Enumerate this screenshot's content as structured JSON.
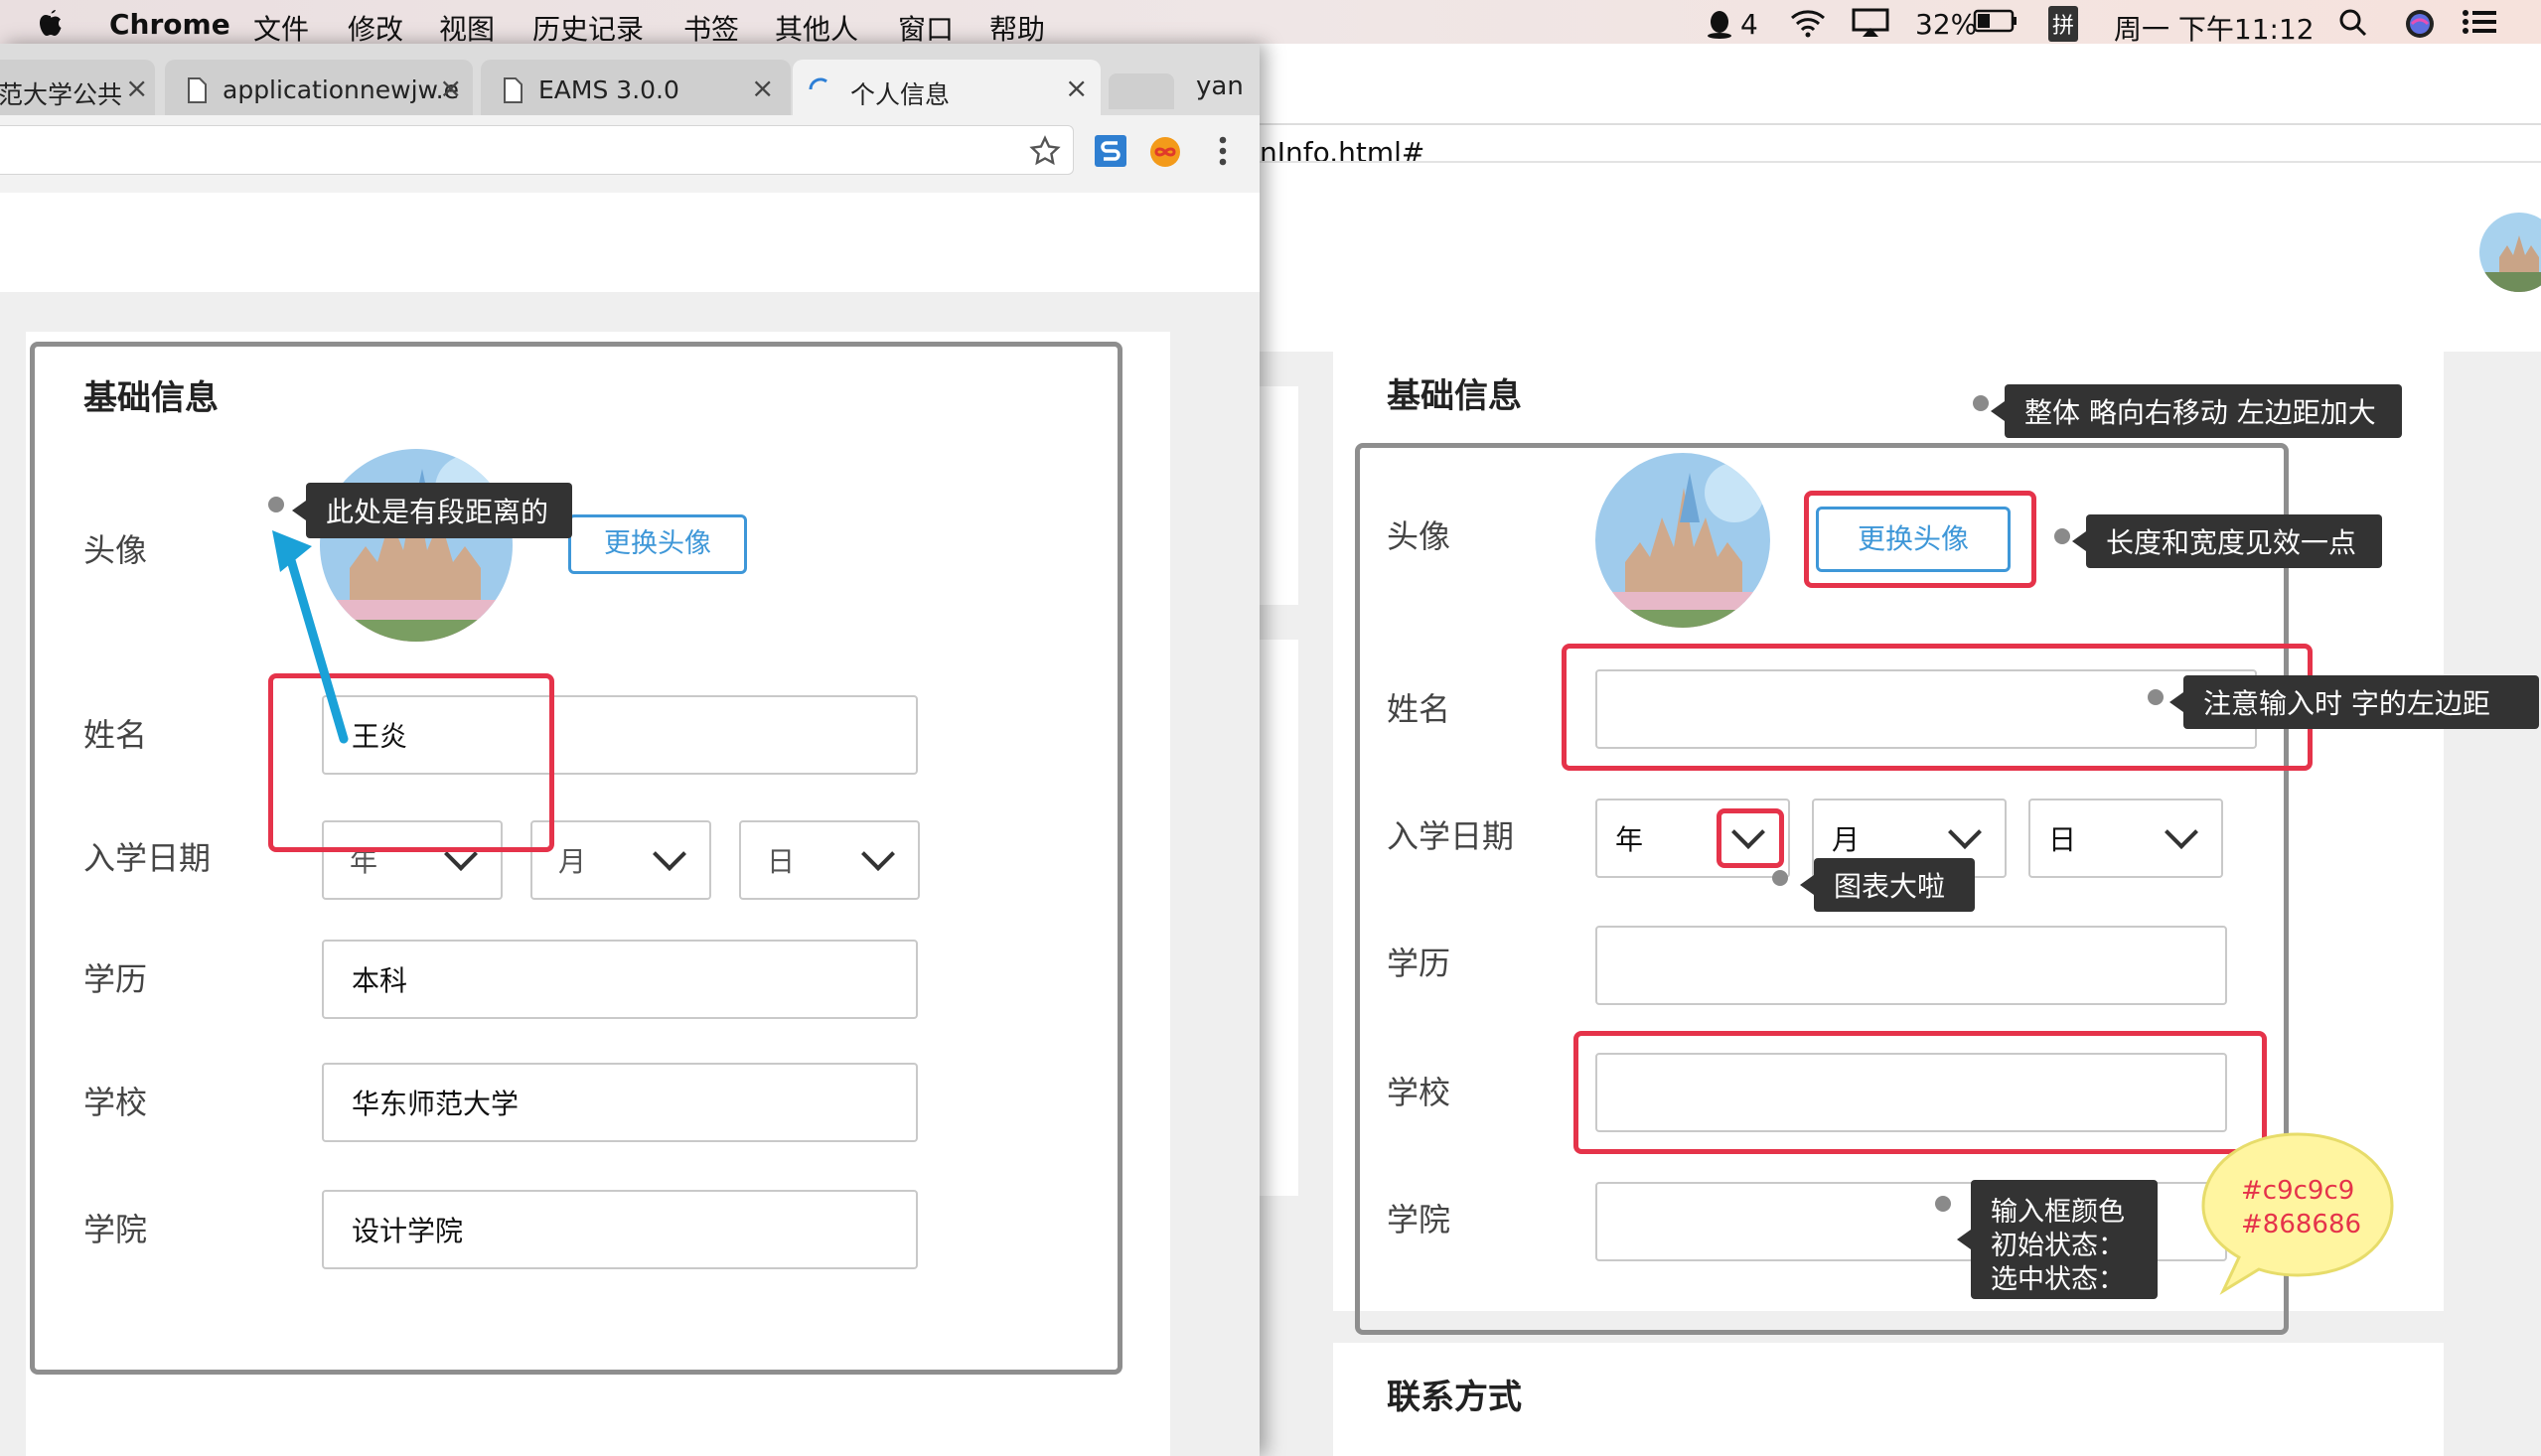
{
  "menubar": {
    "app": "Chrome",
    "items": [
      "文件",
      "修改",
      "视图",
      "历史记录",
      "书签",
      "其他人",
      "窗口",
      "帮助"
    ],
    "qq_count": "4",
    "battery": "32%",
    "input_method": "拼",
    "clock": "周一 下午11:12"
  },
  "browser": {
    "tabs": [
      {
        "label": "范大学公共"
      },
      {
        "label": "applicationnewjw.e"
      },
      {
        "label": "EAMS 3.0.0"
      },
      {
        "label": "个人信息"
      }
    ],
    "profile": "yan",
    "url_fragment": "nInfo.html#"
  },
  "left_form": {
    "section_title": "基础信息",
    "avatar_label": "头像",
    "change_avatar_button": "更换头像",
    "name_label": "姓名",
    "name_value": "王炎",
    "enroll_label": "入学日期",
    "year_placeholder": "年",
    "month_placeholder": "月",
    "day_placeholder": "日",
    "degree_label": "学历",
    "degree_value": "本科",
    "school_label": "学校",
    "school_value": "华东师范大学",
    "college_label": "学院",
    "college_value": "设计学院"
  },
  "right_form": {
    "section_title": "基础信息",
    "avatar_label": "头像",
    "change_avatar_button": "更换头像",
    "name_label": "姓名",
    "enroll_label": "入学日期",
    "year_placeholder": "年",
    "month_placeholder": "月",
    "day_placeholder": "日",
    "degree_label": "学历",
    "school_label": "学校",
    "college_label": "学院",
    "contact_title": "联系方式"
  },
  "annotations": {
    "left_spacing": "此处是有段距离的",
    "move_right": "整体 略向右移动 左边距加大",
    "button_size": "长度和宽度见效一点",
    "input_padding": "注意输入时 字的左边距",
    "icon_larger": "图表大啦",
    "input_color_line1": "输入框颜色",
    "input_color_line2": "初始状态：",
    "input_color_line3": "选中状态：",
    "color_initial": "#c9c9c9",
    "color_selected": "#868686"
  },
  "colors": {
    "accent_blue": "#3e97d8",
    "highlight_red": "#e5334a",
    "arrow_blue": "#1aa1d8",
    "callout_yellow": "#fff5a0"
  }
}
